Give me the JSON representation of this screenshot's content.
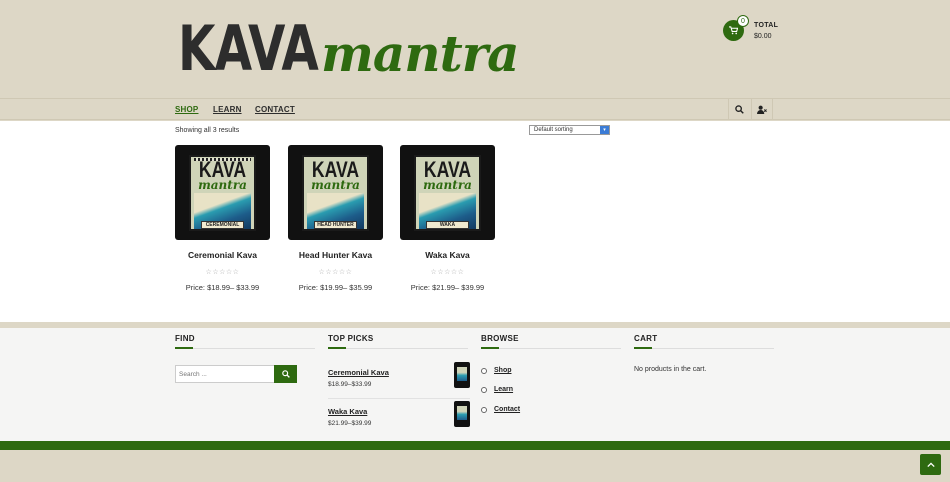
{
  "brand": {
    "logo_part1": "KAVA",
    "logo_part2": "mantra",
    "color_primary": "#2e6a10",
    "color_bg": "#ddd7c6"
  },
  "cart": {
    "count": "0",
    "total_label": "TOTAL",
    "total_value": "$0.00",
    "icon": "cart-icon"
  },
  "nav": {
    "items": [
      {
        "label": "SHOP",
        "active": true
      },
      {
        "label": "LEARN",
        "active": false
      },
      {
        "label": "CONTACT",
        "active": false
      }
    ],
    "search_icon": "search-icon",
    "account_icon": "user-icon"
  },
  "shop": {
    "result_count": "Showing all 3 results",
    "sort_value": "Default sorting",
    "products": [
      {
        "name": "Ceremonial Kava",
        "price_label": "Price:",
        "price": "$18.99– $33.99",
        "bag_label": "CEREMONIAL",
        "bag_kava": "KAVA",
        "bag_mantra": "mantra",
        "rating": "☆☆☆☆☆"
      },
      {
        "name": "Head Hunter Kava",
        "price_label": "Price:",
        "price": "$19.99– $35.99",
        "bag_label": "HEAD HUNTER",
        "bag_kava": "KAVA",
        "bag_mantra": "mantra",
        "rating": "☆☆☆☆☆"
      },
      {
        "name": "Waka Kava",
        "price_label": "Price:",
        "price": "$21.99– $39.99",
        "bag_label": "WAKA",
        "bag_kava": "KAVA",
        "bag_mantra": "mantra",
        "rating": "☆☆☆☆☆"
      }
    ]
  },
  "footer": {
    "find": {
      "title": "FIND",
      "placeholder": "Search ..."
    },
    "top_picks": {
      "title": "TOP PICKS",
      "items": [
        {
          "name": "Ceremonial Kava",
          "price": "$18.99–$33.99"
        },
        {
          "name": "Waka Kava",
          "price": "$21.99–$39.99"
        }
      ]
    },
    "browse": {
      "title": "BROWSE",
      "items": [
        "Shop",
        "Learn",
        "Contact"
      ]
    },
    "cart": {
      "title": "CART",
      "empty_text": "No products in the cart."
    }
  }
}
